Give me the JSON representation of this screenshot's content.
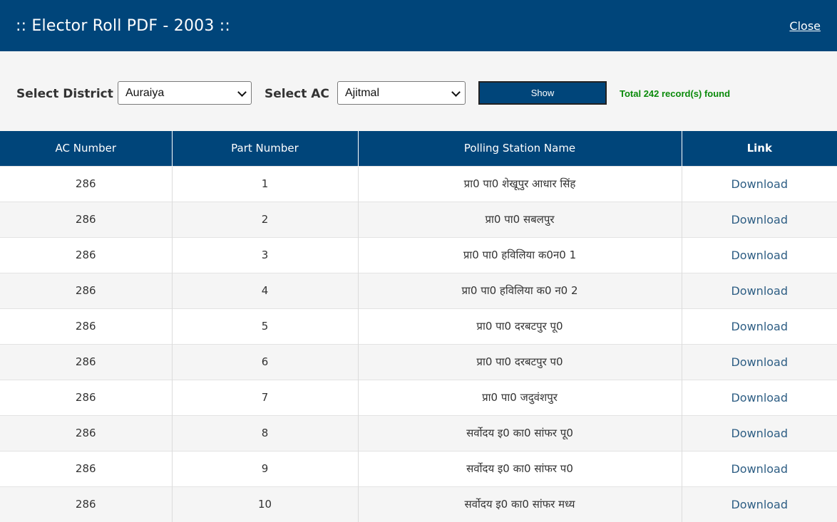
{
  "header": {
    "title": ":: Elector Roll PDF - 2003 ::",
    "close_label": "Close"
  },
  "filters": {
    "district_label": "Select District",
    "district_value": "Auraiya",
    "ac_label": "Select AC",
    "ac_value": "Ajitmal",
    "show_label": "Show",
    "records_text": "Total 242 record(s) found"
  },
  "table": {
    "headers": [
      "AC Number",
      "Part Number",
      "Polling Station Name",
      "Link"
    ],
    "rows": [
      {
        "ac": "286",
        "part": "1",
        "station": "प्रा0 पा0 शेखूपुर आधार सिंह",
        "link": "Download"
      },
      {
        "ac": "286",
        "part": "2",
        "station": "प्रा0 पा0 सबलपुर",
        "link": "Download"
      },
      {
        "ac": "286",
        "part": "3",
        "station": "प्रा0 पा0 हविलिया क0न0 1",
        "link": "Download"
      },
      {
        "ac": "286",
        "part": "4",
        "station": "प्रा0 पा0 हविलिया क0 न0 2",
        "link": "Download"
      },
      {
        "ac": "286",
        "part": "5",
        "station": "प्रा0 पा0 दरबटपुर पू0",
        "link": "Download"
      },
      {
        "ac": "286",
        "part": "6",
        "station": "प्रा0 पा0 दरबटपुर प0",
        "link": "Download"
      },
      {
        "ac": "286",
        "part": "7",
        "station": "प्रा0 पा0 जदुवंशपुर",
        "link": "Download"
      },
      {
        "ac": "286",
        "part": "8",
        "station": "सर्वोदय इ0 का0 सांफर पू0",
        "link": "Download"
      },
      {
        "ac": "286",
        "part": "9",
        "station": "सर्वोदय इ0 का0 सांफर प0",
        "link": "Download"
      },
      {
        "ac": "286",
        "part": "10",
        "station": "सर्वोदय इ0 का0 सांफर मध्य",
        "link": "Download"
      }
    ]
  },
  "colors": {
    "brand": "#00457a",
    "success": "#0a8a0a",
    "link": "#2e5e84"
  }
}
